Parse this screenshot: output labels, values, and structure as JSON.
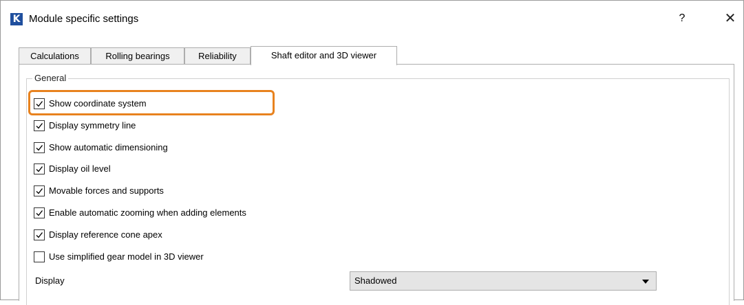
{
  "window": {
    "title": "Module specific settings",
    "logo_letter": "K",
    "help_glyph": "?",
    "close_glyph": "✕",
    "logo_color": "#1f4f9e"
  },
  "tabs": [
    {
      "label": "Calculations",
      "active": false
    },
    {
      "label": "Rolling bearings",
      "active": false
    },
    {
      "label": "Reliability",
      "active": false
    },
    {
      "label": "Shaft editor and 3D viewer",
      "active": true
    }
  ],
  "group": {
    "title": "General",
    "options": [
      {
        "label": "Show coordinate system",
        "checked": true
      },
      {
        "label": "Display symmetry line",
        "checked": true
      },
      {
        "label": "Show automatic dimensioning",
        "checked": true
      },
      {
        "label": "Display oil level",
        "checked": true
      },
      {
        "label": "Movable forces and supports",
        "checked": true
      },
      {
        "label": "Enable automatic zooming when adding elements",
        "checked": true
      },
      {
        "label": "Display reference cone apex",
        "checked": true
      },
      {
        "label": "Use simplified gear model in 3D viewer",
        "checked": false
      }
    ]
  },
  "display": {
    "label": "Display",
    "value": "Shadowed"
  },
  "highlight_color": "#e8821e"
}
